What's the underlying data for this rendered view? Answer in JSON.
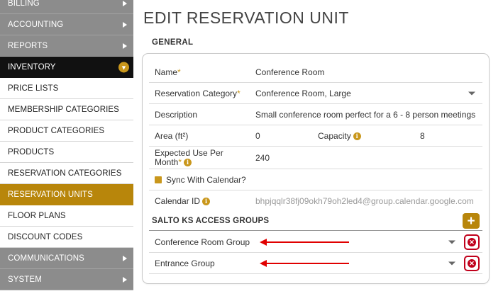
{
  "sidebar": {
    "items": [
      {
        "label": "BILLING",
        "style": "dark",
        "marker": "arrow"
      },
      {
        "label": "ACCOUNTING",
        "style": "dark",
        "marker": "arrow"
      },
      {
        "label": "REPORTS",
        "style": "dark",
        "marker": "arrow"
      },
      {
        "label": "INVENTORY",
        "style": "black",
        "marker": "badge",
        "badge_text": "▼"
      },
      {
        "label": "PRICE LISTS",
        "style": "light"
      },
      {
        "label": "MEMBERSHIP CATEGORIES",
        "style": "light"
      },
      {
        "label": "PRODUCT CATEGORIES",
        "style": "light"
      },
      {
        "label": "PRODUCTS",
        "style": "light"
      },
      {
        "label": "RESERVATION CATEGORIES",
        "style": "light"
      },
      {
        "label": "RESERVATION UNITS",
        "style": "active"
      },
      {
        "label": "FLOOR PLANS",
        "style": "light"
      },
      {
        "label": "DISCOUNT CODES",
        "style": "light"
      },
      {
        "label": "COMMUNICATIONS",
        "style": "dark",
        "marker": "arrow"
      },
      {
        "label": "SYSTEM",
        "style": "dark",
        "marker": "arrow"
      }
    ]
  },
  "page": {
    "title": "EDIT RESERVATION UNIT",
    "general_heading": "GENERAL"
  },
  "form": {
    "name": {
      "label": "Name",
      "required_mark": "*",
      "value": "Conference Room"
    },
    "reservation_category": {
      "label": "Reservation Category",
      "required_mark": "*",
      "value": "Conference Room, Large"
    },
    "description": {
      "label": "Description",
      "value": "Small conference room perfect for a 6 - 8 person meetings"
    },
    "area": {
      "label": "Area (ft²)",
      "value": "0"
    },
    "capacity": {
      "label": "Capacity",
      "value": "8"
    },
    "expected_use": {
      "label_line1": "Expected Use Per",
      "label_line2": "Month",
      "required_mark": "*",
      "value": "240"
    },
    "sync_calendar": {
      "label": "Sync With Calendar?",
      "checked": true
    },
    "calendar_id": {
      "label": "Calendar ID",
      "value": "bhpjqqlr38fj09okh79oh2led4@group.calendar.google.com"
    }
  },
  "salto": {
    "heading": "SALTO KS ACCESS GROUPS",
    "add_label": "+",
    "groups": [
      {
        "value": "Conference Room Group",
        "remove_label": "✕"
      },
      {
        "value": "Entrance Group",
        "remove_label": "✕"
      }
    ]
  },
  "icons": {
    "info": "i",
    "info_icon": "info-icon",
    "dropdown": "chevron-down-icon",
    "remove": "remove-icon",
    "annotation": "red-arrow-annotation"
  },
  "colors": {
    "accent": "#b8860b",
    "sidebar_dark": "#8c8c8c",
    "sidebar_selected_section": "#111111",
    "danger": "#c0001b",
    "annotation_arrow": "#e00000"
  }
}
